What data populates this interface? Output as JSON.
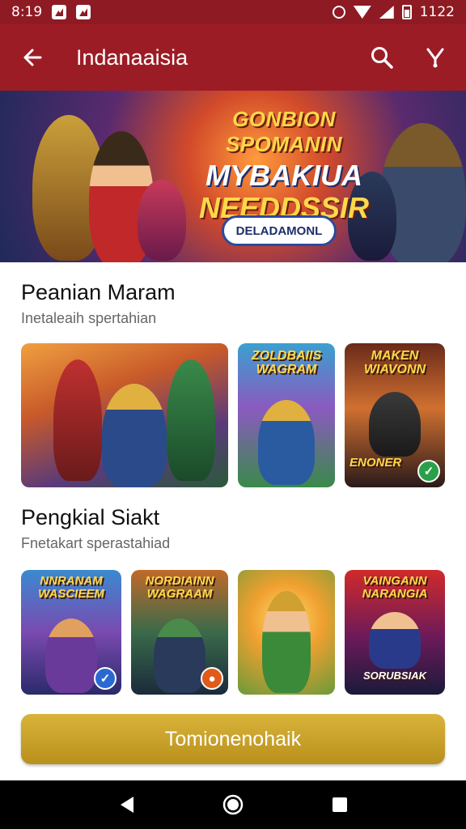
{
  "status_bar": {
    "time": "8:19",
    "battery_level": "1122"
  },
  "app_bar": {
    "title": "Indanaaisia"
  },
  "banner": {
    "line1": "GONBION SPOMANIN",
    "line2": "MYBAKIUA",
    "line3": "NEEDDSSIR",
    "button_label": "DELADAMONL"
  },
  "section1": {
    "title": "Peanian Maram",
    "subtitle": "Inetaleaih spertahian",
    "tiles": [
      {
        "label": ""
      },
      {
        "label": "ZOLDBAIIS WAGRAM"
      },
      {
        "label": "MAKEN WIAVONN",
        "footer": "ENONER"
      }
    ]
  },
  "section2": {
    "title": "Pengkial Siakt",
    "subtitle": "Fnetakart sperastahiad",
    "tiles": [
      {
        "label": "NNRANAM WASCIEEM"
      },
      {
        "label": "NORDIAINN WAGRAAM"
      },
      {
        "label": ""
      },
      {
        "label": "VAINGANN NARANGIA",
        "footer": "SORUBSIAK"
      }
    ]
  },
  "cta": {
    "label": "Tomionenohaik"
  },
  "colors": {
    "brand": "#9c1c26",
    "status": "#8e1a24",
    "cta": "#c9a22a",
    "nav": "#000000"
  },
  "icons": [
    "back-arrow-icon",
    "search-icon",
    "filter-icon",
    "status-notification-icon",
    "back-triangle-icon",
    "home-circle-icon",
    "recents-square-icon"
  ]
}
